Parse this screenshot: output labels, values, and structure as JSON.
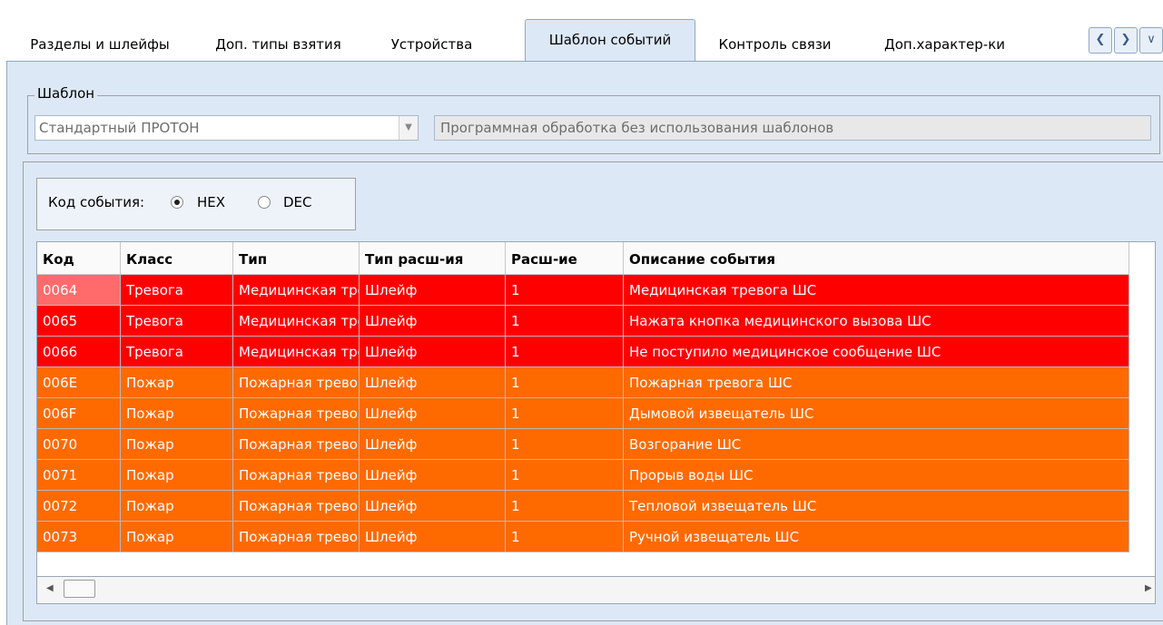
{
  "tabs": [
    {
      "label": "Разделы и шлейфы",
      "active": false
    },
    {
      "label": "Доп. типы взятия",
      "active": false
    },
    {
      "label": "Устройства",
      "active": false
    },
    {
      "label": "Шаблон событий",
      "active": true
    },
    {
      "label": "Контроль связи",
      "active": false
    },
    {
      "label": "Доп.характер-ки",
      "active": false
    }
  ],
  "template": {
    "legend": "Шаблон",
    "selected": "Стандартный ПРОТОН",
    "description": "Программная обработка без использования шаблонов"
  },
  "event_code": {
    "label": "Код события:",
    "options": [
      "HEX",
      "DEC"
    ],
    "selected": "HEX"
  },
  "grid": {
    "columns": [
      "Код",
      "Класс",
      "Тип",
      "Тип расш-ия",
      "Расш-ие",
      "Описание события"
    ],
    "rows": [
      {
        "code": "0064",
        "class": "Тревога",
        "type": "Медицинская тревога",
        "ext_type": "Шлейф",
        "ext": "1",
        "desc": "Медицинская тревога ШС",
        "category": "alarm"
      },
      {
        "code": "0065",
        "class": "Тревога",
        "type": "Медицинская тревога",
        "ext_type": "Шлейф",
        "ext": "1",
        "desc": "Нажата кнопка медицинского вызова ШС",
        "category": "alarm"
      },
      {
        "code": "0066",
        "class": "Тревога",
        "type": "Медицинская тревога",
        "ext_type": "Шлейф",
        "ext": "1",
        "desc": "Не поступило медицинское сообщение ШС",
        "category": "alarm"
      },
      {
        "code": "006E",
        "class": "Пожар",
        "type": "Пожарная тревога",
        "ext_type": "Шлейф",
        "ext": "1",
        "desc": "Пожарная тревога ШС",
        "category": "fire"
      },
      {
        "code": "006F",
        "class": "Пожар",
        "type": "Пожарная тревога",
        "ext_type": "Шлейф",
        "ext": "1",
        "desc": "Дымовой извещатель ШС",
        "category": "fire"
      },
      {
        "code": "0070",
        "class": "Пожар",
        "type": "Пожарная тревога",
        "ext_type": "Шлейф",
        "ext": "1",
        "desc": "Возгорание ШС",
        "category": "fire"
      },
      {
        "code": "0071",
        "class": "Пожар",
        "type": "Пожарная тревога",
        "ext_type": "Шлейф",
        "ext": "1",
        "desc": "Прорыв воды ШС",
        "category": "fire"
      },
      {
        "code": "0072",
        "class": "Пожар",
        "type": "Пожарная тревога",
        "ext_type": "Шлейф",
        "ext": "1",
        "desc": "Тепловой извещатель ШС",
        "category": "fire"
      },
      {
        "code": "0073",
        "class": "Пожар",
        "type": "Пожарная тревога",
        "ext_type": "Шлейф",
        "ext": "1",
        "desc": "Ручной извещатель ШС",
        "category": "fire"
      }
    ]
  },
  "colors": {
    "alarm": "#ff0000",
    "fire": "#ff6a00",
    "panel": "#dde8f6"
  },
  "icons": {
    "tab_prev": "chevron-left-icon",
    "tab_next": "chevron-right-icon",
    "tab_menu": "chevron-down-icon"
  }
}
